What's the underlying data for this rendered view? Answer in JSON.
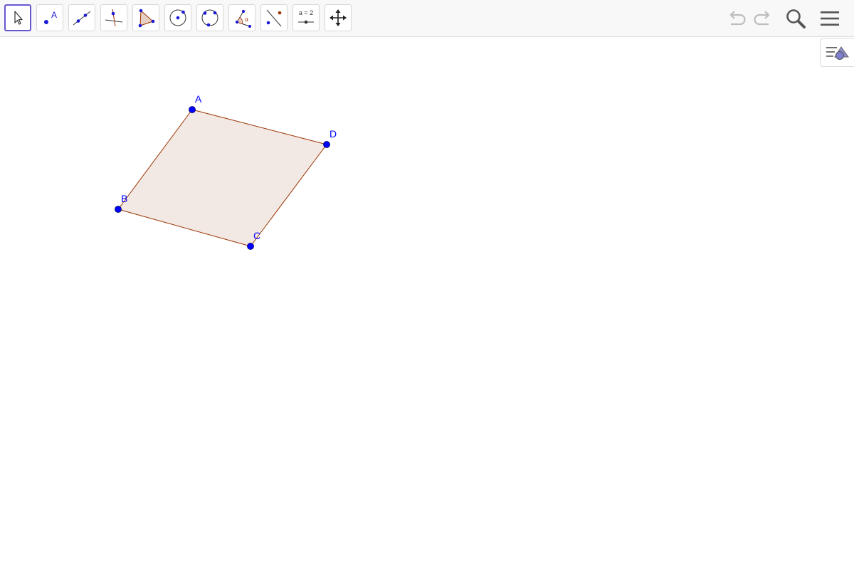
{
  "app": {
    "accent": "#6557d2"
  },
  "toolbar": {
    "tools": [
      {
        "id": "move",
        "icon": "move-arrow-icon",
        "active": true
      },
      {
        "id": "point",
        "icon": "point-icon",
        "glyph": "A"
      },
      {
        "id": "line",
        "icon": "line-icon"
      },
      {
        "id": "perpendicular",
        "icon": "perpendicular-line-icon"
      },
      {
        "id": "polygon",
        "icon": "polygon-icon"
      },
      {
        "id": "circle",
        "icon": "circle-center-point-icon"
      },
      {
        "id": "circle3",
        "icon": "circle-three-points-icon"
      },
      {
        "id": "angle",
        "icon": "angle-icon",
        "glyph": "α"
      },
      {
        "id": "reflect",
        "icon": "reflect-about-line-icon"
      },
      {
        "id": "slider",
        "icon": "slider-icon",
        "glyph": "a = 2"
      },
      {
        "id": "move-view",
        "icon": "move-graphics-view-icon"
      }
    ],
    "right": [
      "undo-icon",
      "redo-icon",
      "search-icon",
      "menu-icon"
    ]
  },
  "style_bar_toggle": {
    "icon": "style-bar-toggle-icon"
  },
  "construction": {
    "colors": {
      "point": "#0000ff",
      "edge": "#993300",
      "fill": "#f3e9e4",
      "label": "#0000ff"
    },
    "points": [
      {
        "name": "A"
      },
      {
        "name": "B"
      },
      {
        "name": "C"
      },
      {
        "name": "D"
      }
    ],
    "polygon": {
      "vertices": [
        "A",
        "D",
        "C",
        "B"
      ]
    }
  }
}
